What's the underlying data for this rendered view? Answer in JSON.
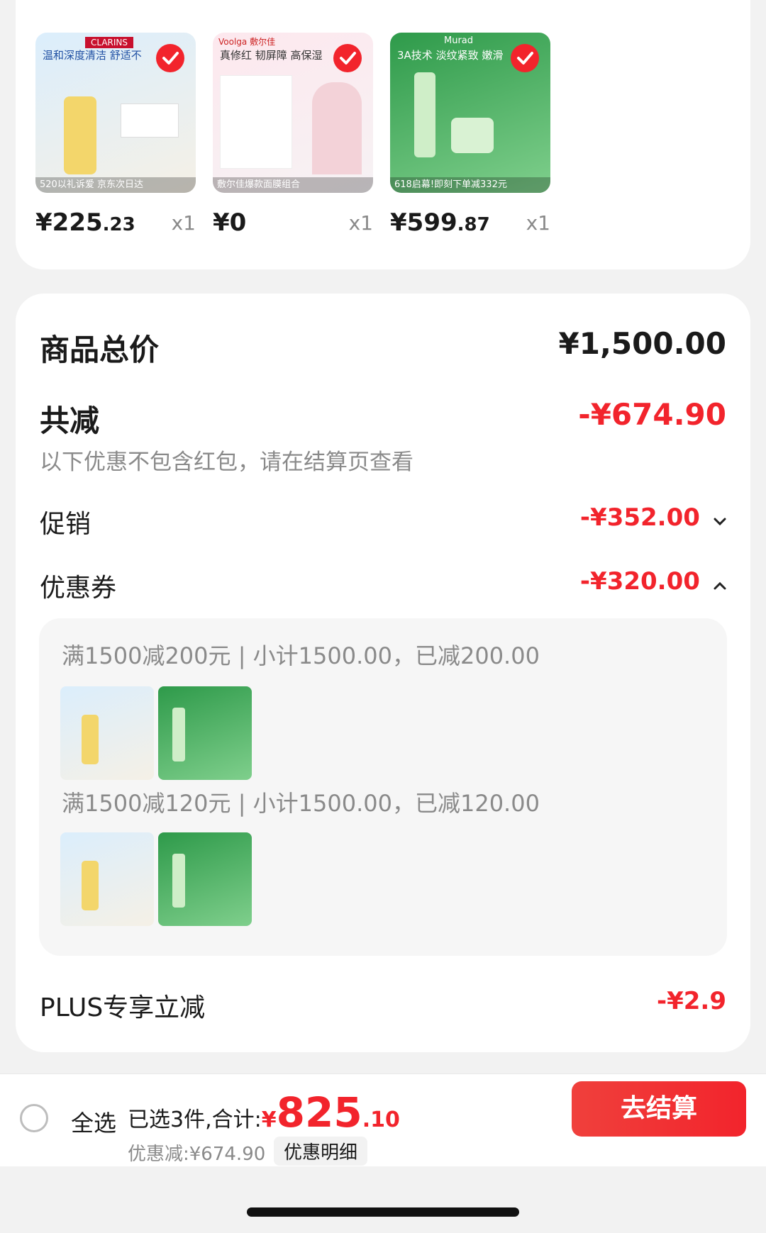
{
  "products": [
    {
      "title": "温和深度清洁 舒适不",
      "brand": "CLARINS",
      "caption": "520以礼诉爱 京东次日达",
      "price_int": "¥225",
      "price_dec": ".23",
      "qty": "x1",
      "checked": true
    },
    {
      "title": "真修红 韧屏障 高保湿",
      "brand": "Voolga 敷尔佳",
      "caption": "敷尔佳爆款面膜组合",
      "price_int": "¥0",
      "price_dec": "",
      "qty": "x1",
      "checked": true
    },
    {
      "title": "3A技术 淡纹紧致 嫩滑",
      "brand": "Murad",
      "caption": "618启幕!即刻下单减332元",
      "price_int": "¥599",
      "price_dec": ".87",
      "qty": "x1",
      "checked": true
    }
  ],
  "summary": {
    "total_label": "商品总价",
    "total_value": "¥1,500.00",
    "reduce_label": "共减",
    "reduce_value": "-¥674.90",
    "reduce_note": "以下优惠不包含红包，请在结算页查看",
    "promo_label": "促销",
    "promo_value": "-¥352.00",
    "coupon_label": "优惠券",
    "coupon_value": "-¥320.00",
    "plus_label": "PLUS专享立减",
    "plus_value": "-¥2.9"
  },
  "coupons": [
    {
      "title": "满1500减200元 | 小计1500.00，已减200.00"
    },
    {
      "title": "满1500减120元 | 小计1500.00，已减120.00"
    }
  ],
  "bottom": {
    "select_all": "全选",
    "selected_text": "已选3件,合计:",
    "total_symbol": "¥",
    "total_int": "825",
    "total_dec": ".10",
    "discount_text": "优惠减:¥674.90",
    "detail_btn": "优惠明细",
    "checkout": "去结算"
  },
  "colors": {
    "accent": "#f2242c"
  }
}
